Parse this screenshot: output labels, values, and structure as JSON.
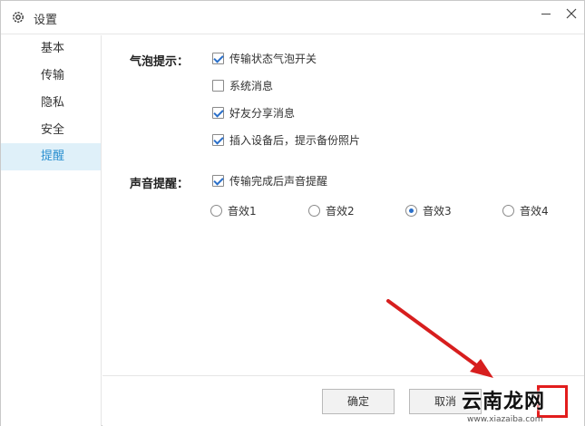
{
  "window": {
    "title": "设置",
    "icon": "gear-icon"
  },
  "sidebar": {
    "items": [
      {
        "label": "基本",
        "active": false
      },
      {
        "label": "传输",
        "active": false
      },
      {
        "label": "隐私",
        "active": false
      },
      {
        "label": "安全",
        "active": false
      },
      {
        "label": "提醒",
        "active": true
      }
    ]
  },
  "bubble": {
    "label": "气泡提示：",
    "options": [
      {
        "label": "传输状态气泡开关",
        "checked": true
      },
      {
        "label": "系统消息",
        "checked": false
      },
      {
        "label": "好友分享消息",
        "checked": true
      },
      {
        "label": "插入设备后，提示备份照片",
        "checked": true
      }
    ]
  },
  "sound": {
    "label": "声音提醒：",
    "option": {
      "label": "传输完成后声音提醒",
      "checked": true
    },
    "effects": [
      {
        "label": "音效1",
        "selected": false
      },
      {
        "label": "音效2",
        "selected": false
      },
      {
        "label": "音效3",
        "selected": true
      },
      {
        "label": "音效4",
        "selected": false
      }
    ]
  },
  "footer": {
    "ok_label": "确定",
    "cancel_label": "取消"
  },
  "watermark": {
    "text": "云南龙网",
    "url": "www.xiazaiba.com"
  },
  "colors": {
    "accent": "#2a8fd0",
    "active_bg": "#dff0f9",
    "annotation": "#e21d1d"
  }
}
